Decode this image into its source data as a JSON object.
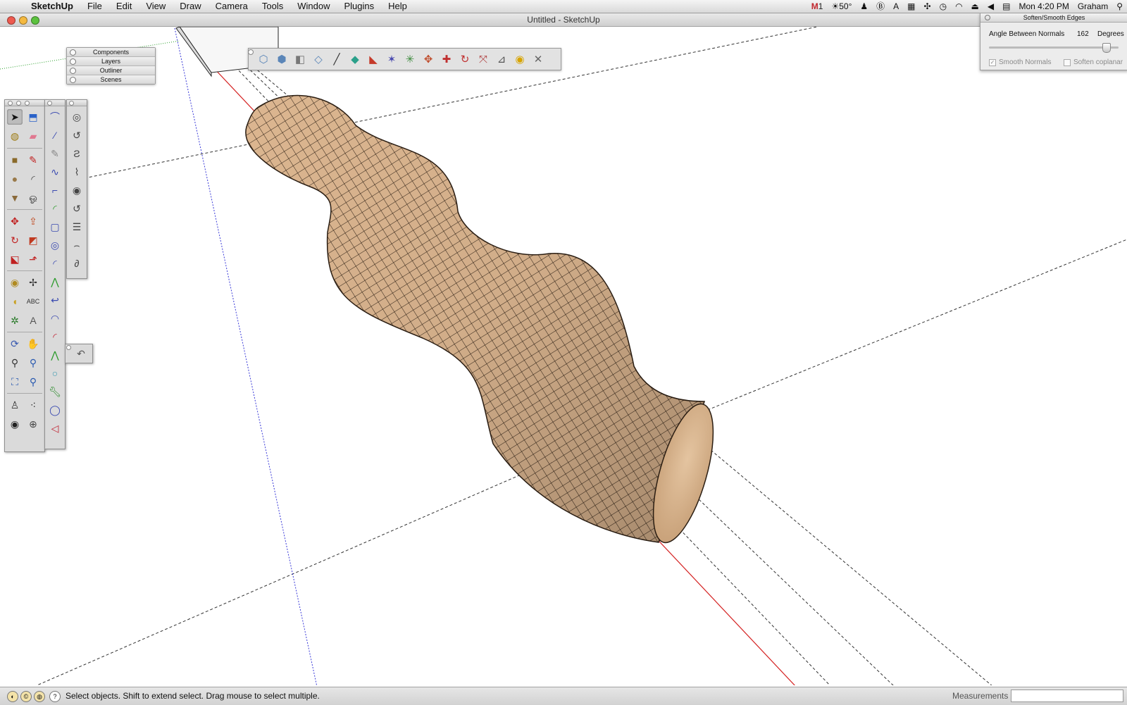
{
  "menubar": {
    "items": [
      "SketchUp",
      "File",
      "Edit",
      "View",
      "Draw",
      "Camera",
      "Tools",
      "Window",
      "Plugins",
      "Help"
    ],
    "status": {
      "gmail_count": "1",
      "weather": "50°",
      "clock": "Mon 4:20 PM",
      "user": "Graham"
    }
  },
  "window": {
    "title": "Untitled - SketchUp"
  },
  "tray": {
    "items": [
      "Components",
      "Layers",
      "Outliner",
      "Scenes"
    ]
  },
  "soften_panel": {
    "title": "Soften/Smooth Edges",
    "angle_label": "Angle Between Normals",
    "angle_value": "162",
    "angle_unit": "Degrees",
    "slider_fraction": 0.9,
    "smooth_normals_label": "Smooth Normals",
    "smooth_normals_checked": true,
    "soften_coplanar_label": "Soften coplanar",
    "soften_coplanar_checked": false
  },
  "statusbar": {
    "message": "Select objects. Shift to extend select. Drag mouse to select multiple.",
    "measurements_label": "Measurements",
    "measurements_value": ""
  },
  "main_tools": [
    "select-icon",
    "make-component-icon",
    "paint-bucket-icon",
    "eraser-icon",
    "rectangle-icon",
    "line-icon",
    "circle-icon",
    "arc-icon",
    "polygon-icon",
    "freehand-icon",
    "move-icon",
    "push-pull-icon",
    "rotate-icon",
    "follow-me-icon",
    "scale-icon",
    "offset-icon",
    "tape-measure-icon",
    "dimension-icon",
    "protractor-icon",
    "text-icon",
    "axes-icon",
    "3d-text-icon",
    "orbit-icon",
    "pan-icon",
    "zoom-icon",
    "zoom-window-icon",
    "zoom-extents-icon",
    "previous-view-icon",
    "position-camera-icon",
    "walk-icon",
    "look-around-icon",
    "section-plane-icon"
  ],
  "curve_tools": [
    "bezier-icon",
    "polyline-icon",
    "spline-icon",
    "catmull-icon",
    "segment-icon",
    "arc-fillet-icon",
    "rounded-rect-icon",
    "spiral-icon",
    "quarter-arc-icon",
    "zigzag-icon",
    "hook-icon",
    "half-arc-icon",
    "red-arc-icon",
    "green-zigzag-icon",
    "circle-outline-icon",
    "wrench-icon",
    "blue-ellipse-icon",
    "red-sector-icon"
  ],
  "spiral_tools": [
    "spiral-1-icon",
    "spiral-2-icon",
    "spiral-3-icon",
    "spiral-4-icon",
    "spiral-5-icon",
    "spiral-6-icon",
    "helix-icon",
    "spiral-7-icon",
    "spiral-8-icon"
  ],
  "top_toolbar": [
    "iso-view-icon",
    "top-view-icon",
    "front-view-icon",
    "right-view-icon",
    "back-view-icon",
    "left-view-icon",
    "sandbox-from-contours-icon",
    "sandbox-from-scratch-icon",
    "smoove-icon",
    "stamp-icon",
    "drape-icon",
    "add-detail-icon",
    "flip-edge-icon",
    "sandbox-tool-1-icon",
    "sandbox-tool-2-icon",
    "sandbox-tool-3-icon",
    "geo-location-icon",
    "plugin-tools-icon"
  ],
  "colors": {
    "tube_fill": "#d9b48c",
    "tube_end_cap": "#dcb895",
    "red_axis": "#d42020",
    "blue_axis": "#3a3ad8",
    "green_axis": "#2ca02c"
  }
}
